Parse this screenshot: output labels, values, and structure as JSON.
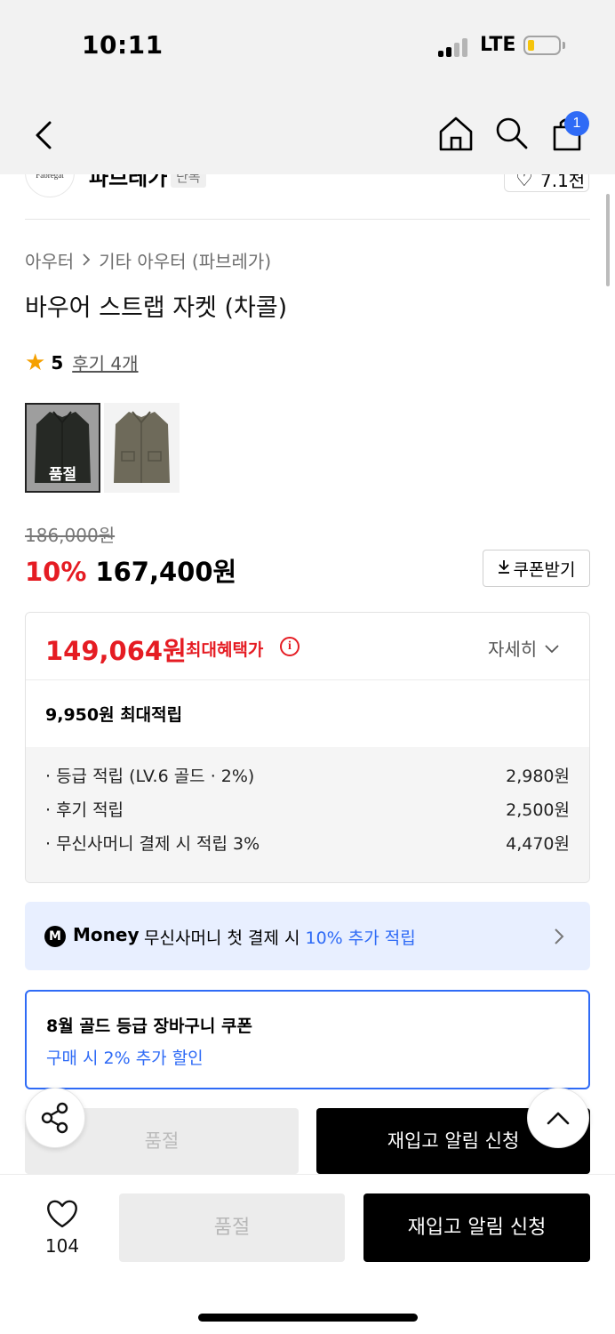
{
  "status_bar": {
    "time": "10:11",
    "network": "LTE",
    "battery_color": "#f5c40c"
  },
  "nav": {
    "back_icon": "chevron-left-icon",
    "home_icon": "home-icon",
    "search_icon": "search-icon",
    "cart_icon": "shopping-bag-icon",
    "cart_badge": "1",
    "badge_color": "#2f6bf6"
  },
  "brand": {
    "logo_text": "Fabregat",
    "name": "파브레가",
    "badge": "단독",
    "like_label": "7.1천"
  },
  "breadcrumb": {
    "items": [
      "아우터",
      "기타 아우터 (파브레가)"
    ]
  },
  "product": {
    "title": "바우어 스트랩 자켓 (차콜)",
    "rating": "5",
    "reviews": "후기 4개",
    "thumbnails": [
      {
        "name": "charcoal-jacket",
        "color": "#3b3f3a",
        "soldout_label": "품절",
        "selected": true
      },
      {
        "name": "khaki-jacket",
        "color": "#6e6a5a",
        "soldout_label": "",
        "selected": false
      }
    ],
    "original_price": "186,000원",
    "discount_rate": "10%",
    "sale_price": "167,400원",
    "coupon_button": "쿠폰받기"
  },
  "benefit": {
    "max_price": "149,064원",
    "max_label": "최대혜택가",
    "detail_label": "자세히",
    "points_total": "9,950원 최대적립",
    "points": [
      {
        "label": "· 등급 적립 (LV.6 골드 · 2%)",
        "amount": "2,980원"
      },
      {
        "label": "· 후기 적립",
        "amount": "2,500원"
      },
      {
        "label": "· 무신사머니 결제 시 적립 3%",
        "amount": "4,470원"
      }
    ]
  },
  "money_banner": {
    "logo": "M",
    "brand": "Money",
    "text": "무신사머니 첫 결제 시 ",
    "highlight": "10% 추가 적립"
  },
  "gold_coupon": {
    "title": "8월 골드 등급 장바구니 쿠폰",
    "subtitle": "구매 시 2% 추가 할인"
  },
  "actions": {
    "soldout_label": "품절",
    "restock_label": "재입고 알림 신청",
    "like_count": "104"
  },
  "colors": {
    "accent_red": "#e51c23",
    "accent_blue": "#2f6bf6"
  }
}
